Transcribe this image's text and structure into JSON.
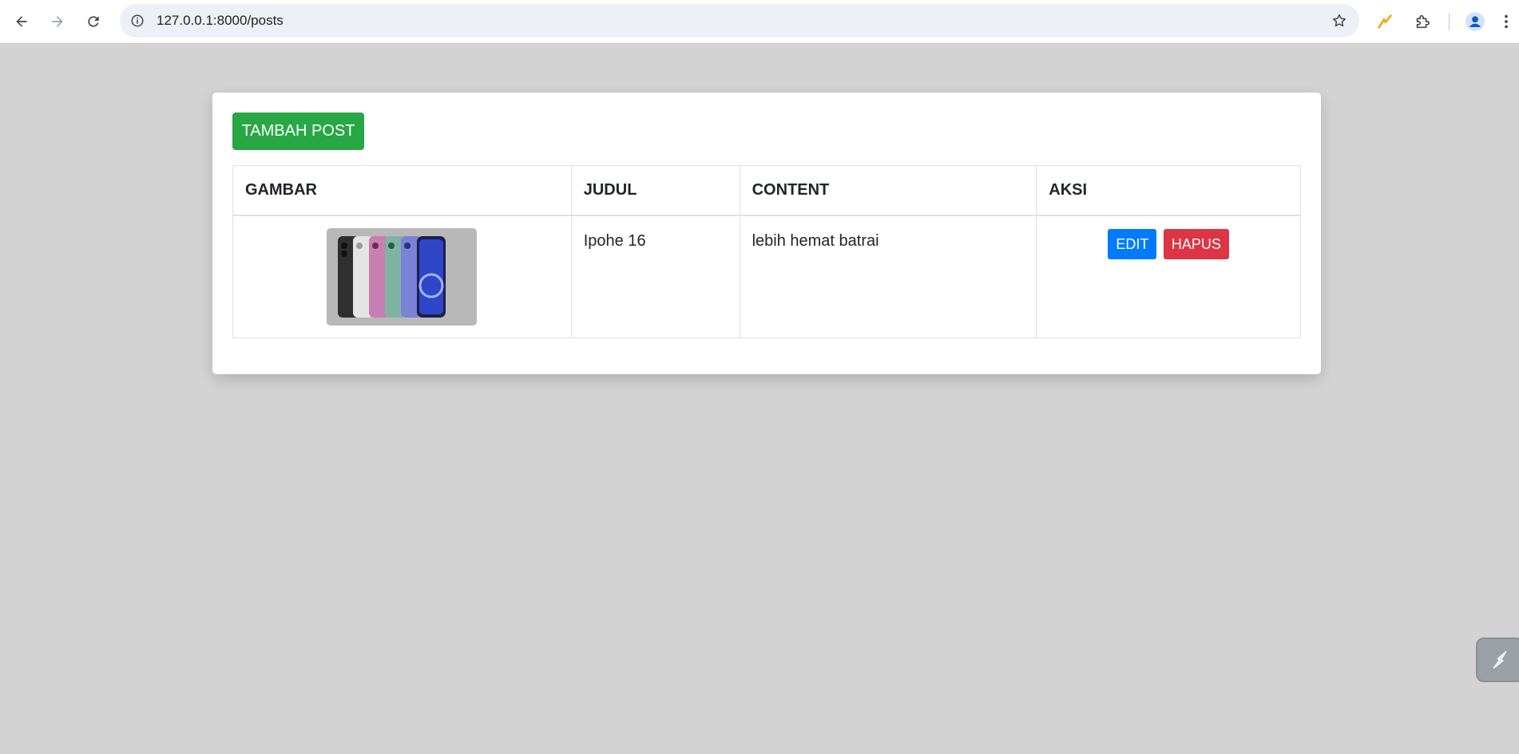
{
  "browser": {
    "url": "127.0.0.1:8000/posts",
    "icons": [
      "back-arrow-icon",
      "forward-arrow-icon",
      "reload-icon",
      "site-info-icon",
      "star-icon",
      "lightning-extension-icon",
      "puzzle-extensions-icon",
      "profile-icon",
      "kebab-menu-icon"
    ]
  },
  "page": {
    "add_post_label": "TAMBAH POST",
    "table": {
      "headers": [
        "GAMBAR",
        "JUDUL",
        "CONTENT",
        "AKSI"
      ],
      "rows": [
        {
          "judul": "Ipohe 16",
          "content": "lebih hemat batrai",
          "edit_label": "EDIT",
          "delete_label": "HAPUS"
        }
      ]
    }
  },
  "colors": {
    "page_background": "#d3d3d3",
    "add_button": "#28a745",
    "edit_button": "#007bff",
    "delete_button": "#dc3545"
  }
}
